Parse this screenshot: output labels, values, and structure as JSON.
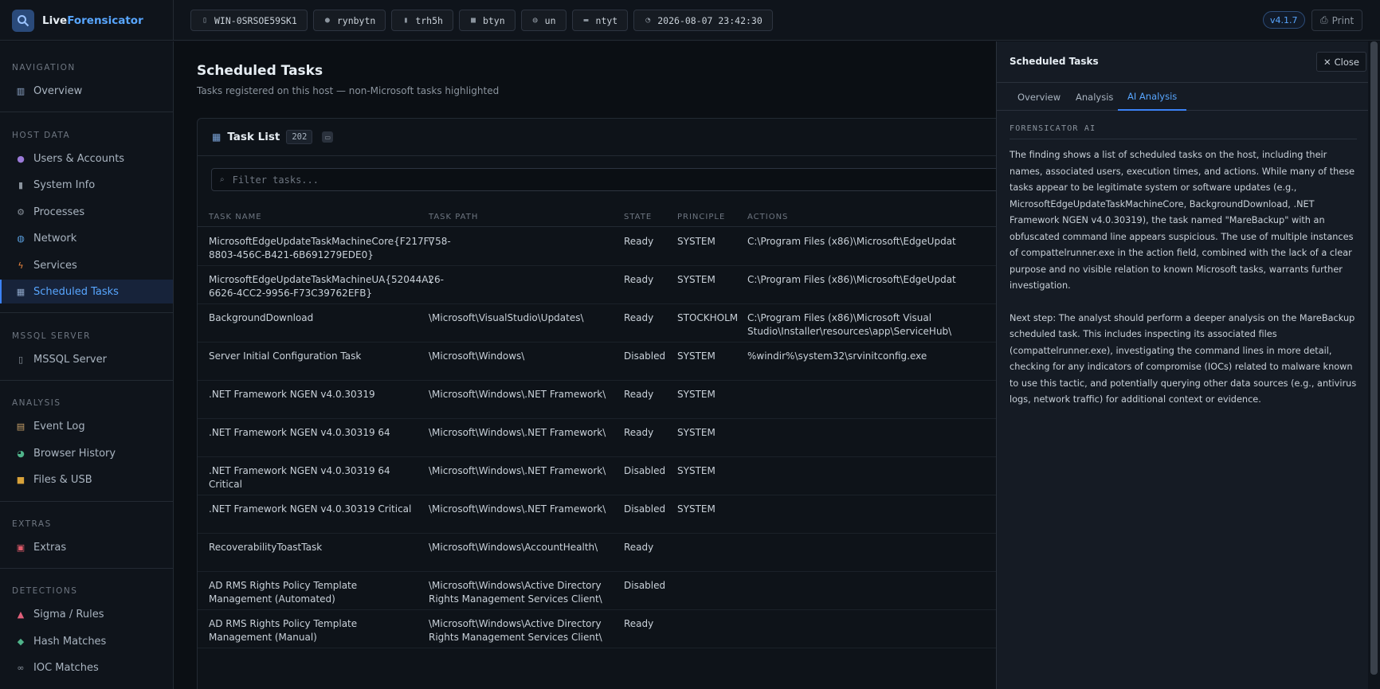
{
  "brand": {
    "name_part1": "Live",
    "name_part2": "Forensicator"
  },
  "topbar": {
    "chips": [
      {
        "icon": "computer-icon",
        "glyph": "▯",
        "value": "WIN-0SRSOE59SK1"
      },
      {
        "icon": "user-icon",
        "glyph": "●",
        "value": "rynbytn"
      },
      {
        "icon": "device-icon",
        "glyph": "▮",
        "value": "trh5h"
      },
      {
        "icon": "folder-icon",
        "glyph": "■",
        "value": "btyn"
      },
      {
        "icon": "globe-icon",
        "glyph": "◍",
        "value": "un"
      },
      {
        "icon": "monitor-icon",
        "glyph": "▬",
        "value": "ntyt"
      },
      {
        "icon": "clock-icon",
        "glyph": "◔",
        "value": "2026-08-07 23:42:30"
      }
    ],
    "version": "v4.1.7",
    "print_label": "Print"
  },
  "sidebar": {
    "sections": {
      "navigation": "NAVIGATION",
      "host_data": "HOST DATA",
      "mssql": "MSSQL SERVER",
      "analysis": "ANALYSIS",
      "extras": "EXTRAS",
      "detections": "DETECTIONS"
    },
    "items": {
      "overview": "Overview",
      "users": "Users & Accounts",
      "sysinfo": "System Info",
      "processes": "Processes",
      "network": "Network",
      "services": "Services",
      "tasks": "Scheduled Tasks",
      "mssql": "MSSQL Server",
      "eventlog": "Event Log",
      "browser": "Browser History",
      "files": "Files & USB",
      "extras": "Extras",
      "sigma": "Sigma / Rules",
      "hash": "Hash Matches",
      "ioc": "IOC Matches"
    }
  },
  "main": {
    "title": "Scheduled Tasks",
    "subtitle": "Tasks registered on this host — non-Microsoft tasks highlighted",
    "card_title": "Task List",
    "count": "202",
    "filter_placeholder": "Filter tasks...",
    "columns": [
      "TASK NAME",
      "TASK PATH",
      "STATE",
      "PRINCIPLE",
      "ACTIONS"
    ],
    "rows": [
      {
        "name": "MicrosoftEdgeUpdateTaskMachineCore{F217F758-8803-456C-B421-6B691279EDE0}",
        "path": "\\",
        "state": "Ready",
        "principle": "SYSTEM",
        "actions": "C:\\Program Files (x86)\\Microsoft\\EdgeUpdat"
      },
      {
        "name": "MicrosoftEdgeUpdateTaskMachineUA{52044A26-6626-4CC2-9956-F73C39762EFB}",
        "path": "\\",
        "state": "Ready",
        "principle": "SYSTEM",
        "actions": "C:\\Program Files (x86)\\Microsoft\\EdgeUpdat"
      },
      {
        "name": "BackgroundDownload",
        "path": "\\Microsoft\\VisualStudio\\Updates\\",
        "state": "Ready",
        "principle": "STOCKHOLM",
        "actions": "C:\\Program Files (x86)\\Microsoft Visual Studio\\Installer\\resources\\app\\ServiceHub\\"
      },
      {
        "name": "Server Initial Configuration Task",
        "path": "\\Microsoft\\Windows\\",
        "state": "Disabled",
        "principle": "SYSTEM",
        "actions": "%windir%\\system32\\srvinitconfig.exe"
      },
      {
        "name": ".NET Framework NGEN v4.0.30319",
        "path": "\\Microsoft\\Windows\\.NET Framework\\",
        "state": "Ready",
        "principle": "SYSTEM",
        "actions": ""
      },
      {
        "name": ".NET Framework NGEN v4.0.30319 64",
        "path": "\\Microsoft\\Windows\\.NET Framework\\",
        "state": "Ready",
        "principle": "SYSTEM",
        "actions": ""
      },
      {
        "name": ".NET Framework NGEN v4.0.30319 64 Critical",
        "path": "\\Microsoft\\Windows\\.NET Framework\\",
        "state": "Disabled",
        "principle": "SYSTEM",
        "actions": ""
      },
      {
        "name": ".NET Framework NGEN v4.0.30319 Critical",
        "path": "\\Microsoft\\Windows\\.NET Framework\\",
        "state": "Disabled",
        "principle": "SYSTEM",
        "actions": ""
      },
      {
        "name": "RecoverabilityToastTask",
        "path": "\\Microsoft\\Windows\\AccountHealth\\",
        "state": "Ready",
        "principle": "",
        "actions": ""
      },
      {
        "name": "AD RMS Rights Policy Template Management (Automated)",
        "path": "\\Microsoft\\Windows\\Active Directory Rights Management Services Client\\",
        "state": "Disabled",
        "principle": "",
        "actions": ""
      },
      {
        "name": "AD RMS Rights Policy Template Management (Manual)",
        "path": "\\Microsoft\\Windows\\Active Directory Rights Management Services Client\\",
        "state": "Ready",
        "principle": "",
        "actions": ""
      }
    ]
  },
  "panel": {
    "title": "Scheduled Tasks",
    "close_label": "Close",
    "tabs": [
      "Overview",
      "Analysis",
      "AI Analysis"
    ],
    "ai_label": "FORENSICATOR AI",
    "ai_paragraphs": [
      "The finding shows a list of scheduled tasks on the host, including their names, associated users, execution times, and actions. While many of these tasks appear to be legitimate system or software updates (e.g., MicrosoftEdgeUpdateTaskMachineCore, BackgroundDownload, .NET Framework NGEN v4.0.30319), the task named \"MareBackup\" with an obfuscated command line appears suspicious. The use of multiple instances of compattelrunner.exe in the action field, combined with the lack of a clear purpose and no visible relation to known Microsoft tasks, warrants further investigation.",
      "Next step: The analyst should perform a deeper analysis on the MareBackup scheduled task. This includes inspecting its associated files (compattelrunner.exe), investigating the command lines in more detail, checking for any indicators of compromise (IOCs) related to malware known to use this tactic, and potentially querying other data sources (e.g., antivirus logs, network traffic) for additional context or evidence."
    ]
  },
  "colors": {
    "accent": "#58a6ff",
    "background": "#0d1117",
    "panel": "#151b24"
  }
}
